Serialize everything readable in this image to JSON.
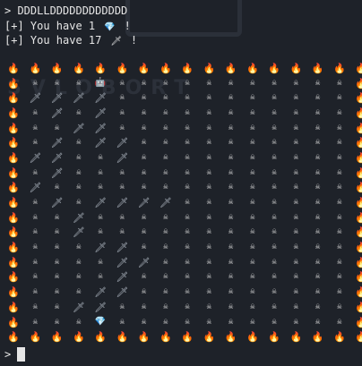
{
  "terminal": {
    "lines": [
      "> DDDLLDDDDDDDDDDDD",
      "[+] You have 1",
      "[+] You have 17"
    ],
    "line_2_icon": "💎",
    "line_2_suffix": " !",
    "line_3_icon": "🗡",
    "line_3_suffix": " !",
    "prompt": ">",
    "watermark": "SVLOBORT"
  },
  "game": {
    "legend": {
      "F": "🔥",
      "S": "☠",
      "T": "🗡",
      "R": "🤖",
      "G": "💎"
    },
    "grid": [
      "FFFFFFFFFFFFFFFFF",
      "FSSSRSSSSSSSSSSSF",
      "FTTTTSSSSSSSSSSSF",
      "FSTSTSSSSSSSSSSSF",
      "FSSTTSSSSSSSSSSSF",
      "FSTSTTSSSSSSSSSSF",
      "FTTSSTSSSSSSSSSSF",
      "FSTSSSSSSSSSSSSSF",
      "FTSSSSSSSSSSSSSSF",
      "FSTSTTTTSSSSSSSSF",
      "FSSTSSSSSSSSSSSSF",
      "FSSTSSSSSSSSSSSSF",
      "FSSSTTSSSSSSSSSSF",
      "FSSSSTTSSSSSSSSSF",
      "FSSSSTSSSSSSSSSSF",
      "FSSSTTSSSSSSSSSSF",
      "FSSTTSSSSSSSSSSSF",
      "FSSSGSSSSSSSSSSSF",
      "FFFFFFFFFFFFFFFFF"
    ]
  }
}
